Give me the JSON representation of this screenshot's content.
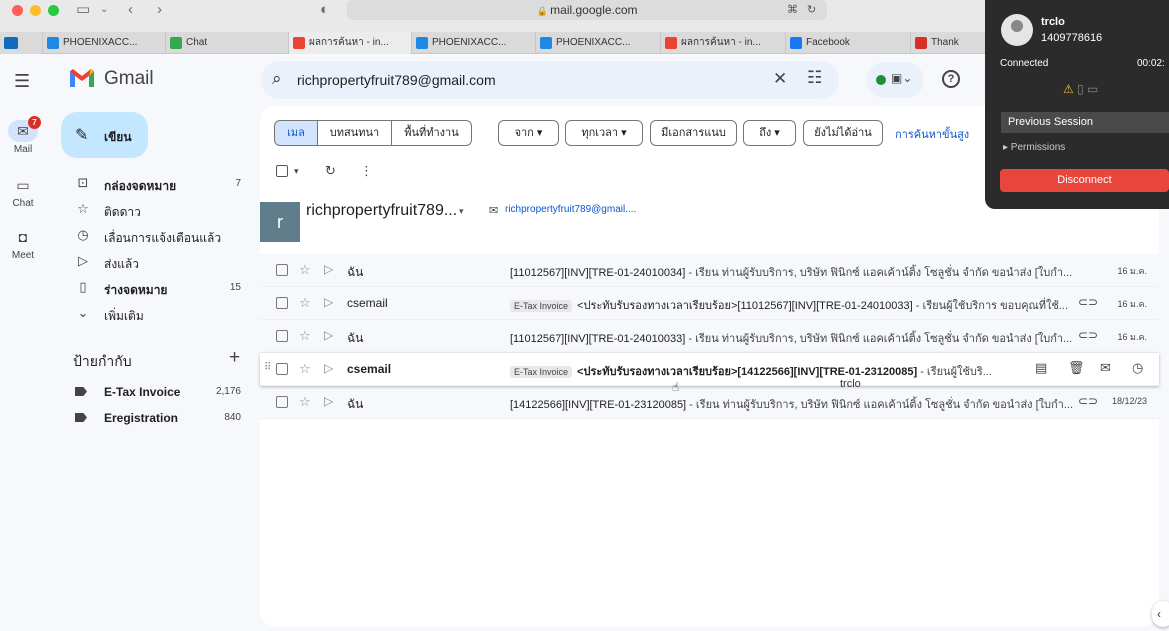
{
  "browser": {
    "url": "mail.google.com",
    "tabs": [
      {
        "label": "PHOENIXACC...",
        "icon_color": "#1e88e5"
      },
      {
        "label": "Chat",
        "icon_color": "#34a853"
      },
      {
        "label": "ผลการค้นหา - in...",
        "icon_color": "#ea4335"
      },
      {
        "label": "PHOENIXACC...",
        "icon_color": "#1e88e5"
      },
      {
        "label": "PHOENIXACC...",
        "icon_color": "#1e88e5"
      },
      {
        "label": "ผลการค้นหา - in...",
        "icon_color": "#ea4335"
      },
      {
        "label": "Facebook",
        "icon_color": "#1877f2"
      },
      {
        "label": "Thank",
        "icon_color": "#d93025"
      }
    ]
  },
  "gmail": {
    "logo_text": "Gmail",
    "search_value": "richpropertyfruit789@gmail.com",
    "rail": {
      "mail": "Mail",
      "chat": "Chat",
      "meet": "Meet",
      "mail_badge": "7"
    },
    "compose_label": "เขียน",
    "nav": [
      {
        "label": "กล่องจดหมาย",
        "count": "7",
        "icon": "inbox-icon",
        "bold": true
      },
      {
        "label": "ติดดาว",
        "count": "",
        "icon": "star-icon",
        "bold": false
      },
      {
        "label": "เลื่อนการแจ้งเตือนแล้ว",
        "count": "",
        "icon": "clock-icon",
        "bold": false
      },
      {
        "label": "ส่งแล้ว",
        "count": "",
        "icon": "send-icon",
        "bold": false
      },
      {
        "label": "ร่างจดหมาย",
        "count": "15",
        "icon": "draft-icon",
        "bold": true
      },
      {
        "label": "เพิ่มเติม",
        "count": "",
        "icon": "chevron-down-icon",
        "bold": false
      }
    ],
    "labels_heading": "ป้ายกำกับ",
    "labels": [
      {
        "label": "E-Tax Invoice",
        "count": "2,176"
      },
      {
        "label": "Eregistration",
        "count": "840"
      }
    ],
    "search_tabs": [
      "เมล",
      "บทสนทนา",
      "พื้นที่ทำงาน"
    ],
    "filters": [
      "จาก",
      "ทุกเวลา",
      "มีเอกสารแนบ",
      "ถึง",
      "ยังไม่ได้อ่าน"
    ],
    "advanced_search": "การค้นหาขั้นสูง",
    "contact": {
      "initial": "r",
      "name": "richpropertyfruit789...",
      "email": "richpropertyfruit789@gmail...."
    },
    "emails": [
      {
        "sender": "ฉัน",
        "tag": "",
        "subject": "[11012567][INV][TRE-01-24010034]",
        "snippet": " - เรียน ท่านผู้รับบริการ, บริษัท ฟินิกซ์ แอคเค้าน์ติ้ง โซลูชั่น จำกัด ขอนำส่ง [ใบกำ...",
        "date": "16 ม.ค.",
        "attachment": false,
        "bold": false
      },
      {
        "sender": "csemail",
        "tag": "E-Tax Invoice",
        "subject": "<ประทับรับรองทางเวลาเรียบร้อย>[11012567][INV][TRE-01-24010033]",
        "snippet": " - เรียนผู้ใช้บริการ ขอบคุณที่ใช้...",
        "date": "16 ม.ค.",
        "attachment": true,
        "bold": false
      },
      {
        "sender": "ฉัน",
        "tag": "",
        "subject": "[11012567][INV][TRE-01-24010033]",
        "snippet": " - เรียน ท่านผู้รับบริการ, บริษัท ฟินิกซ์ แอคเค้าน์ติ้ง โซลูชั่น จำกัด ขอนำส่ง [ใบกำ...",
        "date": "16 ม.ค.",
        "attachment": true,
        "bold": false
      },
      {
        "sender": "csemail",
        "tag": "E-Tax Invoice",
        "subject": "<ประทับรับรองทางเวลาเรียบร้อย>[14122566][INV][TRE-01-23120085]",
        "snippet": " - เรียนผู้ใช้บริ...",
        "date": "",
        "attachment": false,
        "bold": true
      },
      {
        "sender": "ฉัน",
        "tag": "",
        "subject": "[14122566][INV][TRE-01-23120085]",
        "snippet": " - เรียน ท่านผู้รับบริการ, บริษัท ฟินิกซ์ แอคเค้าน์ติ้ง โซลูชั่น จำกัด ขอนำส่ง [ใบกำ...",
        "date": "18/12/23",
        "attachment": true,
        "bold": false
      }
    ],
    "cursor_label": "trclo"
  },
  "remote_session": {
    "name": "trclo",
    "id": "1409778616",
    "status": "Connected",
    "timer": "00:02:",
    "previous_session": "Previous Session",
    "permissions": "▸ Permissions",
    "disconnect": "Disconnect"
  }
}
